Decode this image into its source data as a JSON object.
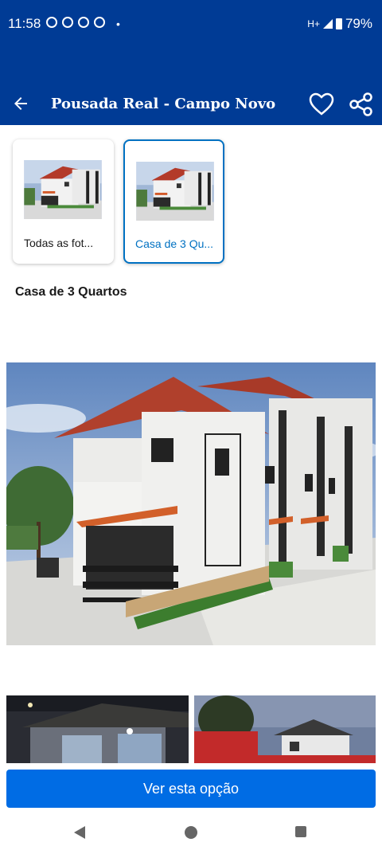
{
  "status_bar": {
    "time": "11:58",
    "dot": "•",
    "network": "H+",
    "battery": "79%",
    "notification_icons": [
      "whatsapp-icon",
      "chat-bubble-icon",
      "chat-bubble-icon",
      "facebook-icon"
    ]
  },
  "app_bar": {
    "title": "Pousada Real - Campo Novo",
    "background": "#003b95",
    "icons": [
      "back-arrow-icon",
      "heart-icon",
      "share-icon"
    ]
  },
  "thumbnails": [
    {
      "label": "Todas as fot...",
      "selected": false
    },
    {
      "label": "Casa de 3 Qu...",
      "selected": true
    }
  ],
  "section": {
    "title": "Casa de 3 Quartos"
  },
  "cta": {
    "label": "Ver esta opção",
    "background": "#006ce4"
  },
  "colors": {
    "brand": "#003b95",
    "accent": "#0071c2"
  }
}
